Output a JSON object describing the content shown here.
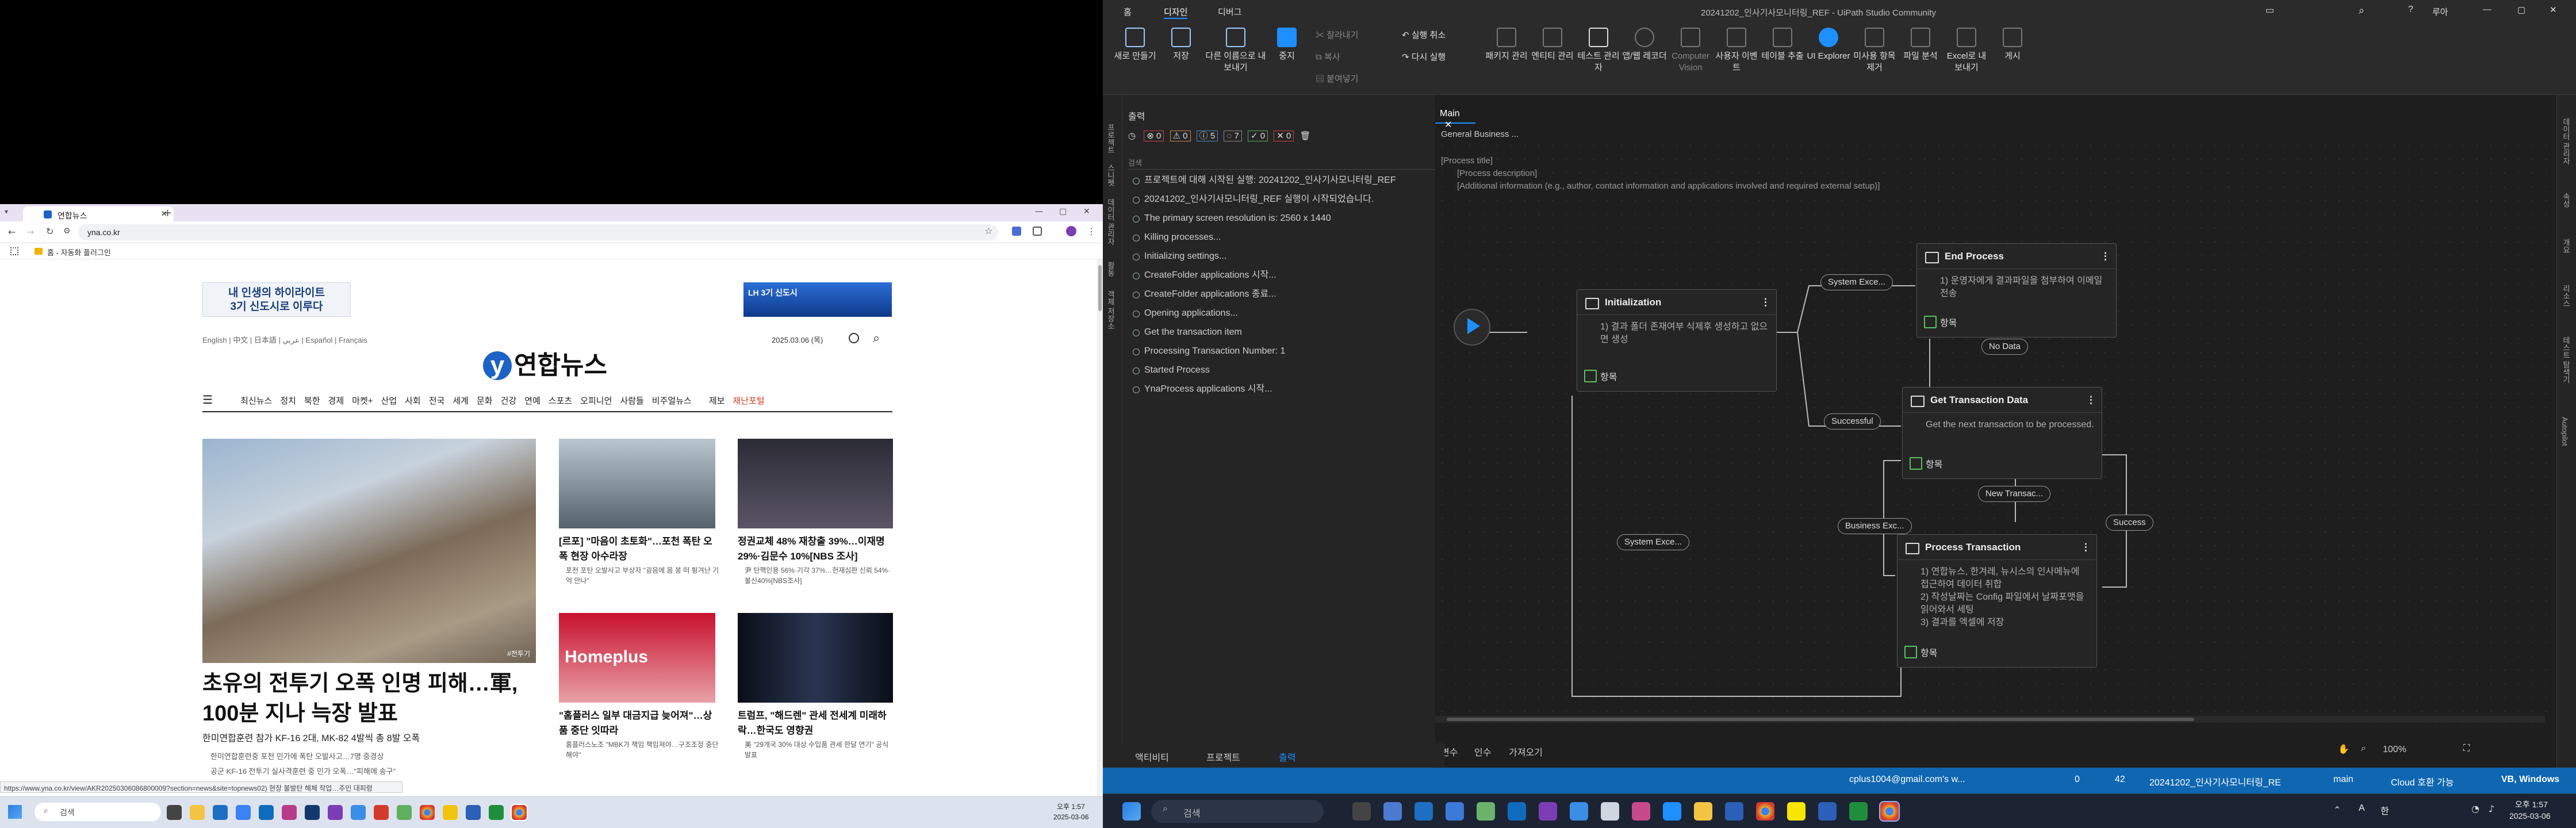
{
  "browser": {
    "tab_title": "연합뉴스",
    "url": "yna.co.kr",
    "bookmark": "홈 - 자동화 플러그인",
    "ad_left": [
      "내 인생의 하이라이트",
      "3기 신도시로 이루다"
    ],
    "ad_right": "LH 3기 신도시",
    "langs": "English | 中文 | 日本語 | عربي | Español | Français",
    "date": "2025.03.06 (목)",
    "logo": "연합뉴스",
    "nav": [
      "최신뉴스",
      "정치",
      "북한",
      "경제",
      "마켓+",
      "산업",
      "사회",
      "전국",
      "세계",
      "문화",
      "건강",
      "연예",
      "스포츠",
      "오피니언",
      "사람들",
      "비주얼뉴스",
      "제보",
      "재난포털"
    ],
    "main_headline": "초유의 전투기 오폭 인명 피해…軍, 100분 지나 늑장 발표",
    "main_sub": "한미연합훈련 참가 KF-16 2대, MK-82 4발씩 총 8발 오폭",
    "main_bullets": [
      "한미연합훈련중 포천 민가에 폭탄 오발사고…7명 중경상",
      "공군 KF-16 전투기 실사격훈련 중 민가 오폭…\"피해에 송구\""
    ],
    "photo_tag": "#전투기",
    "card1_title": "[르포] \"마음이 초토화\"…포천 폭탄 오폭 현장 아수라장",
    "card1_sub": "포천 포탄 오발사고 부상자 \"굉음에 몸 붕 떠 튕겨난 기억 안나\"",
    "card2_title": "정권교체 48% 재창출 39%…이재명 29%·김문수 10%[NBS 조사]",
    "card2_sub": "尹 탄핵인용 56%·기각 37%…헌재심판 신뢰 54%·불신40%[NBS조사]",
    "card3_title": "\"홈플러스 일부 대금지급 늦어져\"…상품 중단 잇따라",
    "card3_sub": "홈플러스노조 \"MBK가 책임 책임져야…구조조정 중단해야\"",
    "card3_img": "Homeplus",
    "card4_title": "트럼프, \"해드렌\" 관세 전세계 미래하락…한국도 영향권",
    "card4_sub": "美 \"29개국 30% 대상 수입품 관세 한달 연기\" 공식 발표",
    "status_url": "https://www.yna.co.kr/view/AKR20250306086800009?section=news&site=topnews02",
    "status_tail": ") 현장 불발탄 해체 작업…주민 대피령",
    "taskbar_search": "검색",
    "clock_time": "오후 1:57",
    "clock_date": "2025-03-06"
  },
  "studio": {
    "tabs": [
      "홈",
      "디자인",
      "디버그"
    ],
    "title": "20241202_인사기사모니터링_REF - UiPath Studio Community",
    "user": "루아",
    "ribbon": [
      "새로 만들기",
      "저장",
      "다른 이름으로 내보내기",
      "중지",
      "잘라내기",
      "복사",
      "붙여넣기",
      "실행 취소",
      "다시 실행",
      "패키지 관리",
      "엔티티 관리",
      "테스트 관리자",
      "앱/웹 레코더",
      "Computer Vision",
      "사용자 이벤트",
      "테이블 추출",
      "UI Explorer",
      "미사용 항목 제거",
      "파일 분석",
      "Excel로 내보내기",
      "게시"
    ],
    "output_title": "출력",
    "output_counts": [
      "0",
      "0",
      "5",
      "7",
      "0",
      "0"
    ],
    "search_label": "검색",
    "output_lines": [
      "프로젝트에 대해 시작된 실행: 20241202_인사기사모니터링_REF",
      "20241202_인사기사모니터링_REF 실행이 시작되었습니다.",
      "The primary screen resolution is: 2560 x 1440",
      "Killing processes...",
      "Initializing settings...",
      "CreateFolder applications 시작...",
      "CreateFolder applications 종료...",
      "Opening applications...",
      "Get the transaction item",
      "Processing Transaction Number: 1",
      "Started Process",
      "YnaProcess applications 시작..."
    ],
    "side_left": [
      "프로젝트",
      "스니펫",
      "데이터 관리자",
      "활동",
      "객체 저장소"
    ],
    "side_right": [
      "데이터 관리자",
      "속성",
      "개요",
      "리소스",
      "테스트 탐색기",
      "Autopilot"
    ],
    "doc_tab": "Main",
    "breadcrumb": "General Business ...",
    "annotation": [
      "[Process title]",
      "[Process description]",
      "[Additional information (e.g., author, contact information and applications involved and required external setup)]"
    ],
    "states": {
      "init": {
        "title": "Initialization",
        "desc": "1) 결과 폴더 존재여부 식제후 생성하고 없으면 생성",
        "entry": "항목"
      },
      "end": {
        "title": "End Process",
        "desc": "1) 운영자에게 결과파일을 첨부하여 이메일 전송",
        "entry": "항목"
      },
      "get": {
        "title": "Get Transaction Data",
        "desc": "Get the next transaction to be processed.",
        "entry": "항목"
      },
      "proc": {
        "title": "Process Transaction",
        "desc": [
          "1) 연합뉴스, 한겨레, 뉴시스의 인사메뉴에 접근하여 데이터 취합",
          "2) 작성날짜는 Config 파일에서 날짜포맷을 읽어와서 세팅",
          "3) 결과를 엑셀에 저장"
        ],
        "entry": "항목"
      }
    },
    "transitions": [
      "System Exce...",
      "No Data",
      "Successful",
      "New Transac...",
      "Business Exc...",
      "Success",
      "System Exce..."
    ],
    "bottom_tabs": [
      "액티비티",
      "프로젝트",
      "출력"
    ],
    "designer_bottom": [
      "변수",
      "인수",
      "가져오기"
    ],
    "zoom": "100%",
    "status": {
      "publish": "",
      "user": "cplus1004@gmail.com's w...",
      "errors": "0",
      "warnings": "42",
      "project": "20241202_인사기사모니터링_RE",
      "branch": "main",
      "cloud": "Cloud 호환 가능",
      "platform": "VB, Windows"
    }
  },
  "win_taskbar": {
    "search": "검색",
    "ime": "A",
    "lang": "한",
    "time": "오후 1:57",
    "date": "2025-03-06"
  }
}
